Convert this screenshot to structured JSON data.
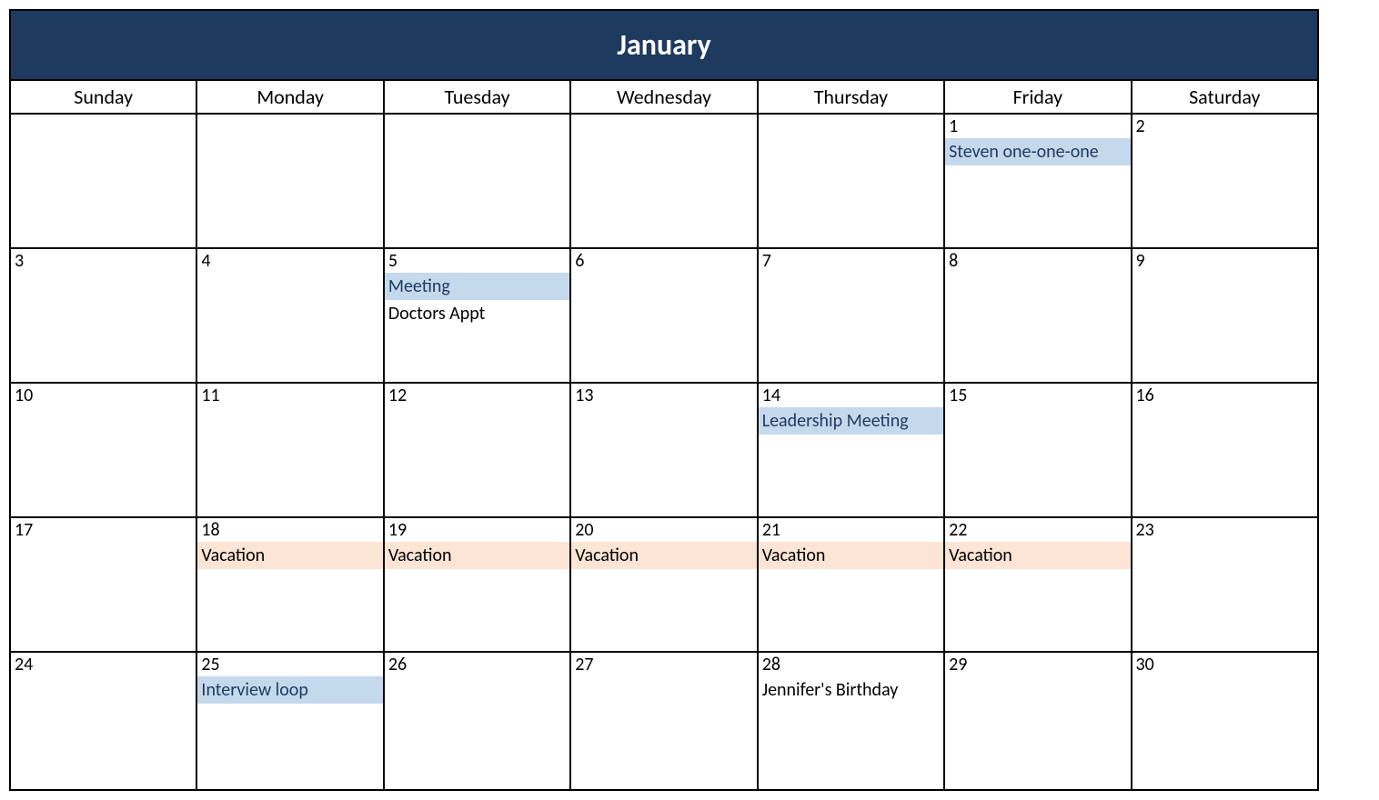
{
  "month_title": "January",
  "day_headers": [
    "Sunday",
    "Monday",
    "Tuesday",
    "Wednesday",
    "Thursday",
    "Friday",
    "Saturday"
  ],
  "weeks": [
    [
      {
        "date": "",
        "events": []
      },
      {
        "date": "",
        "events": []
      },
      {
        "date": "",
        "events": []
      },
      {
        "date": "",
        "events": []
      },
      {
        "date": "",
        "events": []
      },
      {
        "date": "1",
        "events": [
          {
            "label": "Steven one-one-one",
            "style": "blue"
          }
        ]
      },
      {
        "date": "2",
        "events": []
      }
    ],
    [
      {
        "date": "3",
        "events": []
      },
      {
        "date": "4",
        "events": []
      },
      {
        "date": "5",
        "events": [
          {
            "label": "Meeting",
            "style": "blue"
          },
          {
            "label": "Doctors Appt",
            "style": "plain"
          }
        ]
      },
      {
        "date": "6",
        "events": []
      },
      {
        "date": "7",
        "events": []
      },
      {
        "date": "8",
        "events": []
      },
      {
        "date": "9",
        "events": []
      }
    ],
    [
      {
        "date": "10",
        "events": []
      },
      {
        "date": "11",
        "events": []
      },
      {
        "date": "12",
        "events": []
      },
      {
        "date": "13",
        "events": []
      },
      {
        "date": "14",
        "events": [
          {
            "label": "Leadership Meeting",
            "style": "blue"
          }
        ]
      },
      {
        "date": "15",
        "events": []
      },
      {
        "date": "16",
        "events": []
      }
    ],
    [
      {
        "date": "17",
        "events": []
      },
      {
        "date": "18",
        "events": [
          {
            "label": "Vacation",
            "style": "peach"
          }
        ]
      },
      {
        "date": "19",
        "events": [
          {
            "label": "Vacation",
            "style": "peach"
          }
        ]
      },
      {
        "date": "20",
        "events": [
          {
            "label": "Vacation",
            "style": "peach"
          }
        ]
      },
      {
        "date": "21",
        "events": [
          {
            "label": "Vacation",
            "style": "peach"
          }
        ]
      },
      {
        "date": "22",
        "events": [
          {
            "label": "Vacation",
            "style": "peach"
          }
        ]
      },
      {
        "date": "23",
        "events": []
      }
    ],
    [
      {
        "date": "24",
        "events": []
      },
      {
        "date": "25",
        "events": [
          {
            "label": "Interview loop",
            "style": "blue"
          }
        ]
      },
      {
        "date": "26",
        "events": []
      },
      {
        "date": "27",
        "events": []
      },
      {
        "date": "28",
        "events": [
          {
            "label": "Jennifer's Birthday",
            "style": "plain"
          }
        ]
      },
      {
        "date": "29",
        "events": []
      },
      {
        "date": "30",
        "events": []
      }
    ]
  ]
}
